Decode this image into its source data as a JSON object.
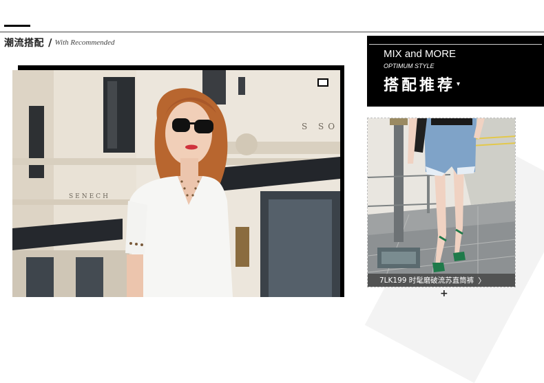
{
  "section": {
    "title": "潮流搭配",
    "slash": "/",
    "subtitle": "With Recommended"
  },
  "promo": {
    "title": "MIX and MORE",
    "subtitle": "OPTIMUM STYLE",
    "heading": "搭配推荐",
    "caret": "▾"
  },
  "product": {
    "label": "7LK199 时髦磨破流苏直筒裤",
    "arrow": "〉"
  },
  "photo_signage": {
    "left_sign": "SENECH",
    "right_sign": "S  SO"
  },
  "colors": {
    "promo_bg": "#000000",
    "denim": "#7fa3c8",
    "sandal": "#1f7a4a",
    "blouse": "#f6f6f4",
    "hair": "#b8662f"
  },
  "icons": {
    "plus": "+",
    "caret": "caret-down-icon",
    "arrow": "chevron-right-icon"
  }
}
